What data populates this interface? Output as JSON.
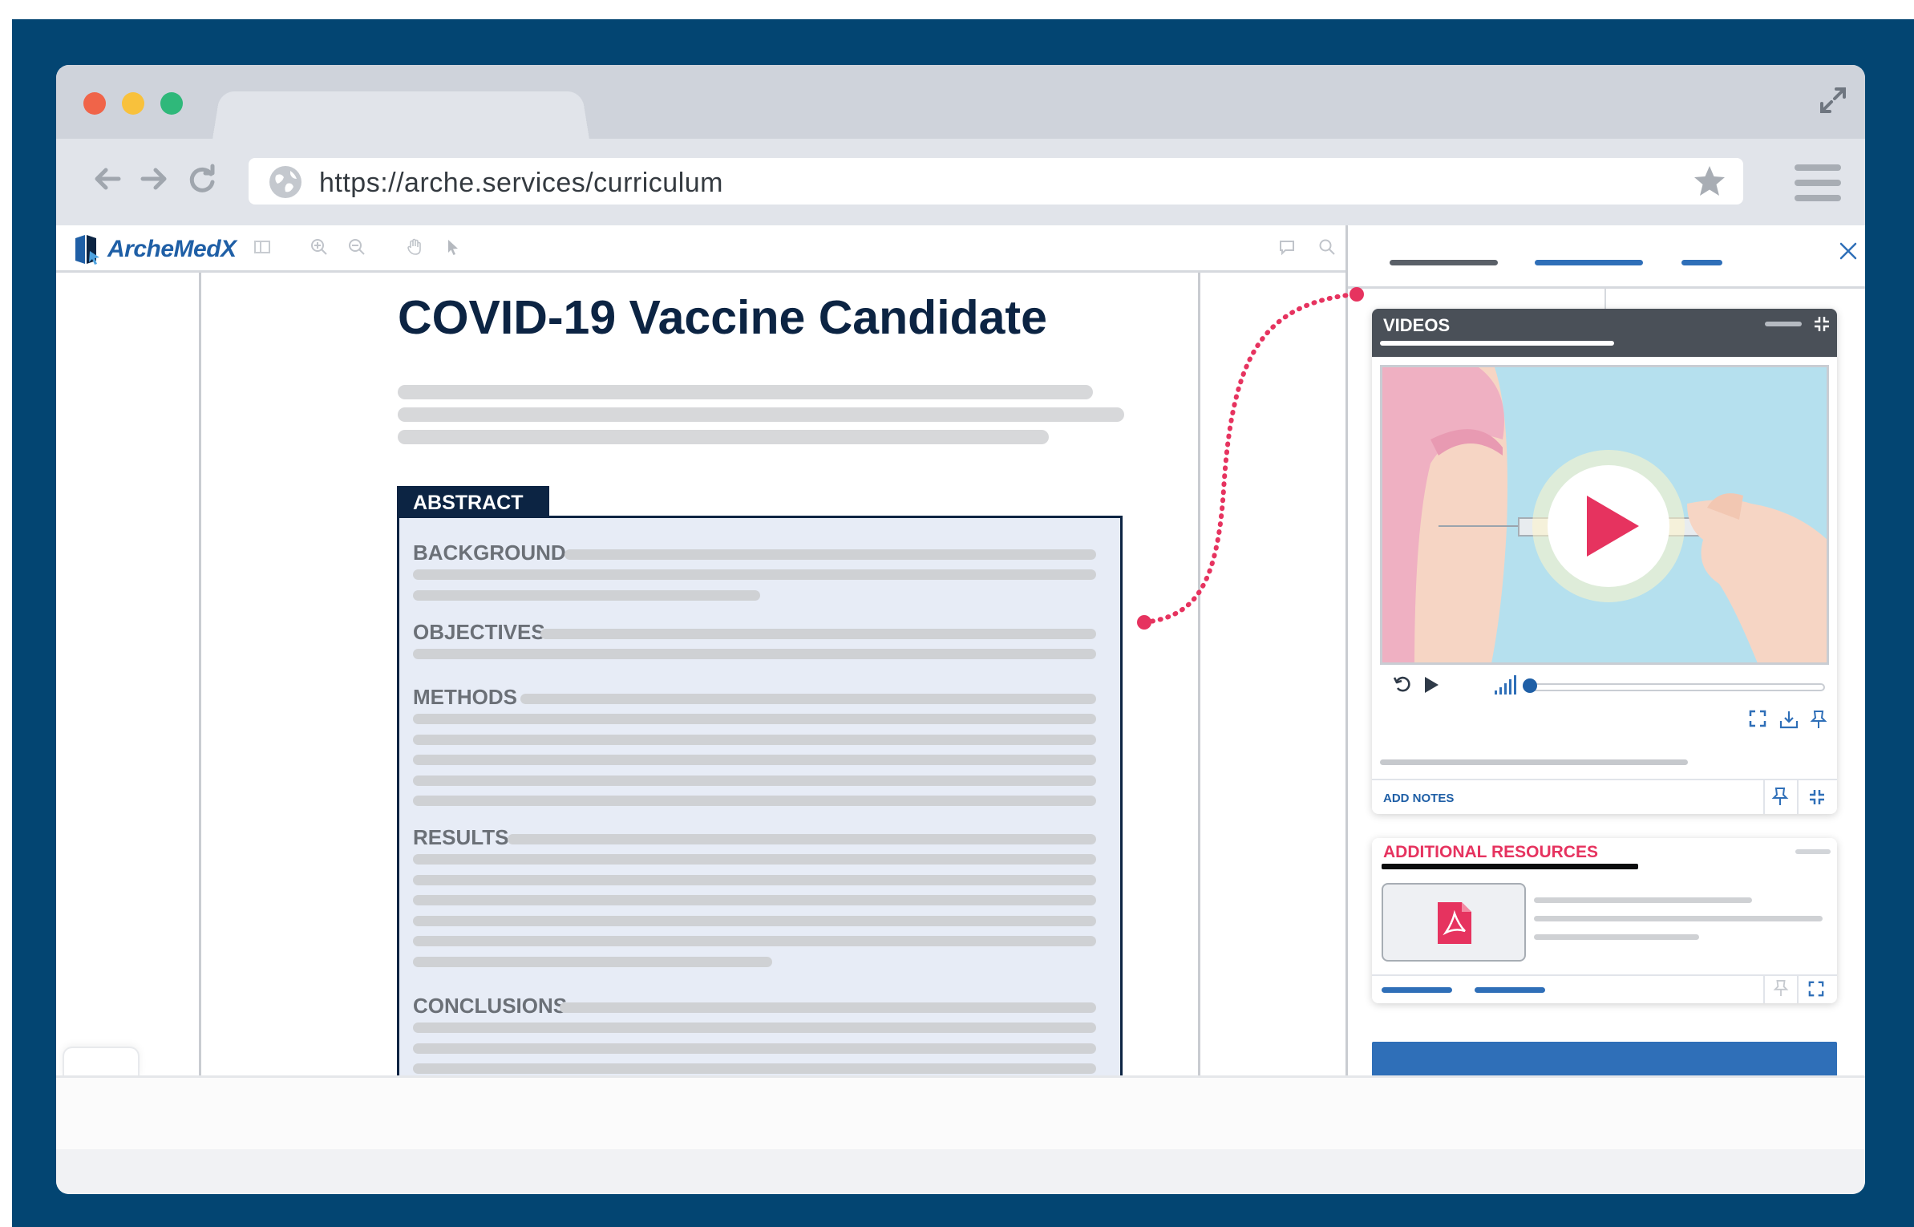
{
  "browser": {
    "url": "https://arche.services/curriculum",
    "traffic_lights": [
      "#f06449",
      "#f8c13c",
      "#2fb87a"
    ]
  },
  "viewer": {
    "logo_text": "ArcheMedX",
    "document_title": "COVID-19 Vaccine Candidate",
    "abstract_tab": "ABSTRACT",
    "sections": {
      "background": "BACKGROUND",
      "objectives": "OBJECTIVES",
      "methods": "METHODS",
      "results": "RESULTS",
      "conclusions": "CONCLUSIONS"
    }
  },
  "sidebar": {
    "videos_title": "VIDEOS",
    "add_notes": "ADD NOTES",
    "resources_title": "ADDITIONAL RESOURCES",
    "video_progress": 0.0
  },
  "colors": {
    "frame": "#034572",
    "brand_blue": "#1f5fa6",
    "accent_pink": "#e6335f",
    "navy": "#0c2443"
  }
}
